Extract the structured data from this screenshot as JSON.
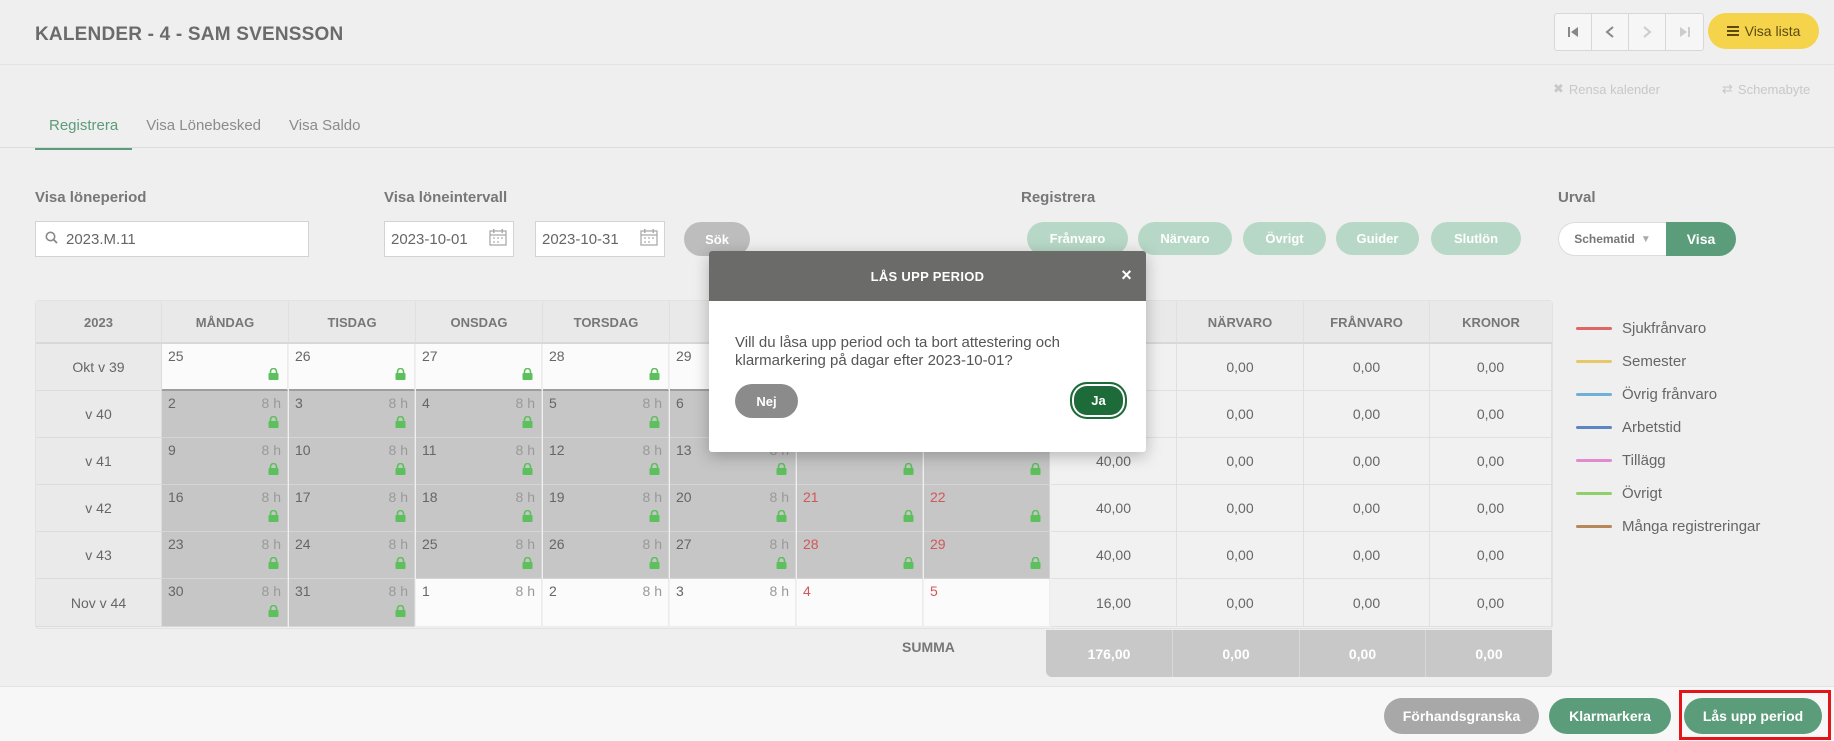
{
  "header": {
    "title": "KALENDER - 4 - SAM SVENSSON",
    "visa_lista": "Visa lista"
  },
  "tools": {
    "rensa": "Rensa kalender",
    "schemabyte": "Schemabyte"
  },
  "tabs": [
    "Registrera",
    "Visa Lönebesked",
    "Visa Saldo"
  ],
  "filters": {
    "loneperiod_label": "Visa löneperiod",
    "loneperiod_value": "2023.M.11",
    "loneintervall_label": "Visa löneintervall",
    "from_date": "2023-10-01",
    "to_date": "2023-10-31",
    "sok": "Sök",
    "registrera_label": "Registrera",
    "reg_buttons": [
      "Frånvaro",
      "Närvaro",
      "Övrigt",
      "Guider",
      "Slutlön"
    ],
    "urval_label": "Urval",
    "urval_select": "Schematid",
    "urval_visa": "Visa"
  },
  "calendar": {
    "year": "2023",
    "days_header": [
      "MÅNDAG",
      "TISDAG",
      "ONSDAG",
      "TORSDAG",
      "F",
      "",
      ""
    ],
    "sum_header": [
      "",
      "NÄRVARO",
      "FRÅNVARO",
      "KRONOR"
    ],
    "weeks": [
      {
        "label": "Okt v 39",
        "days": [
          "25",
          "26",
          "27",
          "28",
          "29",
          "",
          ""
        ],
        "sums": [
          "",
          "0,00",
          "0,00",
          "0,00"
        ]
      },
      {
        "label": "v 40",
        "days": [
          "2",
          "3",
          "4",
          "5",
          "6",
          "",
          ""
        ],
        "sums": [
          "",
          "0,00",
          "0,00",
          "0,00"
        ]
      },
      {
        "label": "v 41",
        "days": [
          "9",
          "10",
          "11",
          "12",
          "13",
          "",
          ""
        ],
        "sums": [
          "40,00",
          "0,00",
          "0,00",
          "0,00"
        ]
      },
      {
        "label": "v 42",
        "days": [
          "16",
          "17",
          "18",
          "19",
          "20",
          "21",
          "22"
        ],
        "sums": [
          "40,00",
          "0,00",
          "0,00",
          "0,00"
        ]
      },
      {
        "label": "v 43",
        "days": [
          "23",
          "24",
          "25",
          "26",
          "27",
          "28",
          "29"
        ],
        "sums": [
          "40,00",
          "0,00",
          "0,00",
          "0,00"
        ]
      },
      {
        "label": "Nov v 44",
        "days": [
          "30",
          "31",
          "1",
          "2",
          "3",
          "4",
          "5"
        ],
        "sums": [
          "16,00",
          "0,00",
          "0,00",
          "0,00"
        ]
      }
    ],
    "hours": "8 h",
    "summa_label": "SUMMA",
    "summa": [
      "176,00",
      "0,00",
      "0,00",
      "0,00"
    ]
  },
  "legend": [
    {
      "label": "Sjukfrånvaro",
      "color": "#e06666"
    },
    {
      "label": "Semester",
      "color": "#e6c86a"
    },
    {
      "label": "Övrig frånvaro",
      "color": "#6fb0d8"
    },
    {
      "label": "Arbetstid",
      "color": "#5f86c4"
    },
    {
      "label": "Tillägg",
      "color": "#e08ad0"
    },
    {
      "label": "Övrigt",
      "color": "#8fd06b"
    },
    {
      "label": "Många registreringar",
      "color": "#b8875a"
    }
  ],
  "footer": {
    "forhandsgranska": "Förhandsgranska",
    "klarmarkera": "Klarmarkera",
    "las_upp": "Lås upp period"
  },
  "modal": {
    "title": "LÅS UPP PERIOD",
    "message": "Vill du låsa upp period och ta bort attestering och klarmarkering på dagar efter 2023-10-01?",
    "nej": "Nej",
    "ja": "Ja"
  }
}
